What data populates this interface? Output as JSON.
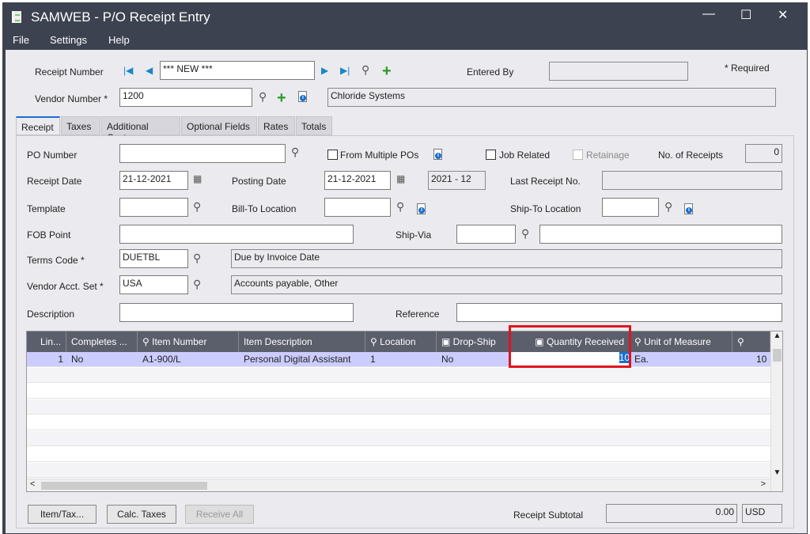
{
  "window": {
    "title": "SAMWEB - P/O Receipt Entry",
    "minimize": "—",
    "maximize": "☐",
    "close": "✕"
  },
  "menu": [
    "File",
    "Settings",
    "Help"
  ],
  "header": {
    "receipt_number_label": "Receipt Number",
    "receipt_number": "*** NEW ***",
    "entered_by_label": "Entered By",
    "entered_by": "",
    "required_note": "* Required",
    "vendor_number_label": "Vendor Number *",
    "vendor_number": "1200",
    "vendor_name": "Chloride Systems"
  },
  "tabs": [
    {
      "label": "Receipt",
      "active": true
    },
    {
      "label": "Taxes"
    },
    {
      "label": "Additional Costs"
    },
    {
      "label": "Optional Fields"
    },
    {
      "label": "Rates"
    },
    {
      "label": "Totals"
    }
  ],
  "form": {
    "po_number_label": "PO Number",
    "po_number": "",
    "from_multiple_pos": "From Multiple POs",
    "job_related": "Job Related",
    "retainage": "Retainage",
    "no_receipts_label": "No. of Receipts",
    "no_receipts": "0",
    "receipt_date_label": "Receipt Date",
    "receipt_date": "21-12-2021",
    "posting_date_label": "Posting Date",
    "posting_date": "21-12-2021",
    "period": "2021 - 12",
    "last_receipt_label": "Last Receipt No.",
    "last_receipt": "",
    "template_label": "Template",
    "bill_to_label": "Bill-To Location",
    "ship_to_label": "Ship-To Location",
    "fob_label": "FOB Point",
    "ship_via_label": "Ship-Via",
    "terms_label": "Terms Code *",
    "terms_code": "DUETBL",
    "terms_desc": "Due by Invoice Date",
    "vendor_acct_label": "Vendor Acct. Set *",
    "vendor_acct": "USA",
    "vendor_acct_desc": "Accounts payable, Other",
    "description_label": "Description",
    "reference_label": "Reference"
  },
  "grid": {
    "columns": [
      "Lin...",
      "Completes ...",
      "Item Number",
      "Item Description",
      "Location",
      "Drop-Ship",
      "Quantity Received",
      "Unit of Measure",
      ""
    ],
    "rows": [
      {
        "line": "1",
        "completes": "No",
        "item": "A1-900/L",
        "desc": "Personal  Digital Assistant",
        "location": "1",
        "dropship": "No",
        "qty": "10",
        "uom": "Ea.",
        "extra": "10"
      }
    ]
  },
  "footer": {
    "item_tax": "Item/Tax...",
    "calc_taxes": "Calc. Taxes",
    "receive_all": "Receive All",
    "subtotal_label": "Receipt Subtotal",
    "subtotal": "0.00",
    "currency": "USD"
  },
  "colors": {
    "highlight": "#e0141e",
    "selected_row": "#ccccff",
    "header": "#5b5e6b"
  }
}
